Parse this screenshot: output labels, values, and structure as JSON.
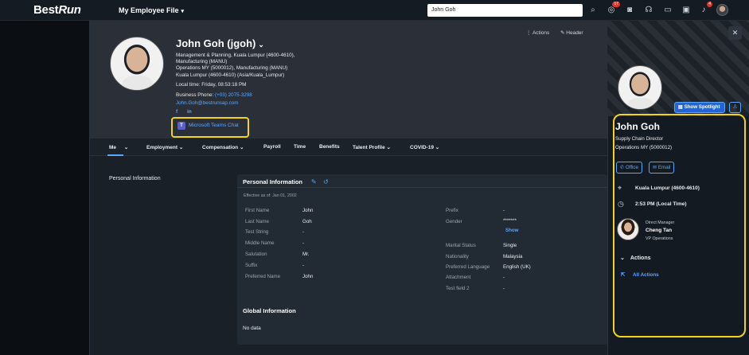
{
  "shell": {
    "logo_best": "Best",
    "logo_run": "Run",
    "app_title": "My Employee File",
    "search_value": "John Goh",
    "notif_count_1": "17",
    "notif_count_2": "4"
  },
  "header": {
    "name": "John Goh (jgoh)",
    "line1": "Management & Planning, Kuala Lumpur (4600-4610),",
    "line2": "Manufacturing (MANU)",
    "line3": "Operations MY (5000012), Manufacturing (MANU)",
    "line4": "Kuala Lumpur (4600-4610) (Asia/Kuala_Lumpur)",
    "local_time": "Local time: Friday, 08:53:18 PM",
    "business_phone_label": "Business Phone:",
    "business_phone": "(+03) 2075-3298",
    "email": "John.Goh@bestrunsap.com",
    "social_f": "f",
    "social_in": "in",
    "teams_label": "Microsoft Teams Chat",
    "actions_label": "Actions",
    "header_label": "Header"
  },
  "tabs": [
    {
      "label": "Me"
    },
    {
      "label": "Employment"
    },
    {
      "label": "Compensation"
    },
    {
      "label": "Payroll"
    },
    {
      "label": "Time"
    },
    {
      "label": "Benefits"
    },
    {
      "label": "Talent Profile"
    },
    {
      "label": "COVID-19"
    }
  ],
  "content": {
    "section_label": "Personal Information",
    "card_title": "Personal Information",
    "effective": "Effective as of: Jan 01, 2002",
    "left_fields": [
      {
        "label": "First Name",
        "value": "John"
      },
      {
        "label": "Last Name",
        "value": "Goh"
      },
      {
        "label": "Test String",
        "value": "-"
      },
      {
        "label": "Middle Name",
        "value": "-"
      },
      {
        "label": "Salutation",
        "value": "Mr."
      },
      {
        "label": "Suffix",
        "value": "-"
      },
      {
        "label": "Preferred Name",
        "value": "John"
      }
    ],
    "right_fields": [
      {
        "label": "Prefix",
        "value": "-"
      },
      {
        "label": "Gender",
        "value": "*******"
      },
      {
        "label": "Marital Status",
        "value": "Single"
      },
      {
        "label": "Nationality",
        "value": "Malaysia"
      },
      {
        "label": "Preferred Language",
        "value": "English (UK)"
      },
      {
        "label": "Attachment",
        "value": "-"
      },
      {
        "label": "Test field 2",
        "value": "-"
      }
    ],
    "show_link": "Show",
    "global_title": "Global Information",
    "no_data": "No data"
  },
  "quickcard": {
    "show_spotlight": "Show Spotlight",
    "name": "John Goh",
    "title": "Supply Chain Director",
    "department": "Operations MY (5000012)",
    "office_btn": "Office",
    "email_btn": "Email",
    "location": "Kuala Lumpur (4600-4610)",
    "local_time": "2:53 PM (Local Time)",
    "manager_label": "Direct Manager",
    "manager_name": "Cheng Tan",
    "manager_role": "VP Operations",
    "actions_header": "Actions",
    "all_actions": "All Actions"
  }
}
